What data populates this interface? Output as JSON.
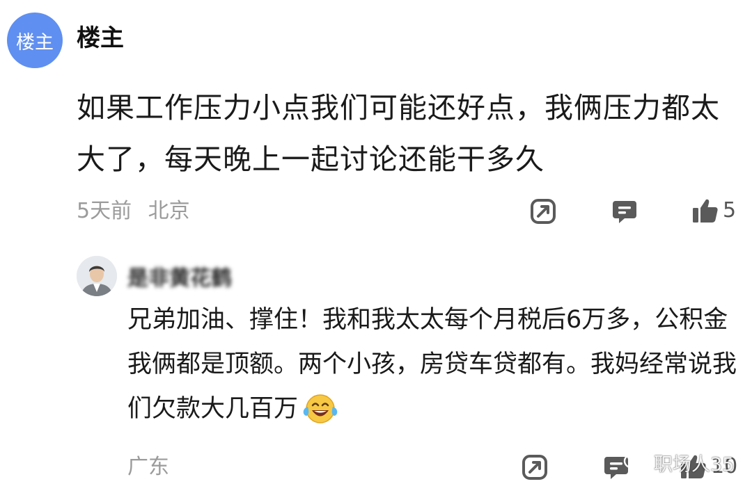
{
  "post": {
    "avatar_text": "楼主",
    "author": "楼主",
    "content": "如果工作压力小点我们可能还好点，我俩压力都太大了，每天晚上一起讨论还能干多久",
    "time": "5天前",
    "location": "北京",
    "like_count": "5"
  },
  "reply": {
    "author": "是非黄花鹤",
    "content": "兄弟加油、撑住！我和我太太每个月税后6万多，公积金我俩都是顶额。两个小孩，房贷车贷都有。我妈经常说我们欠款大几百万",
    "emoji": "laughing-with-tears-emoji",
    "location": "广东",
    "like_count": "10"
  },
  "watermark": {
    "text": "职场人35"
  },
  "colors": {
    "avatar_bg": "#5f8ff0",
    "meta_gray": "#9b9b9b",
    "icon_gray": "#5a5a5a"
  }
}
